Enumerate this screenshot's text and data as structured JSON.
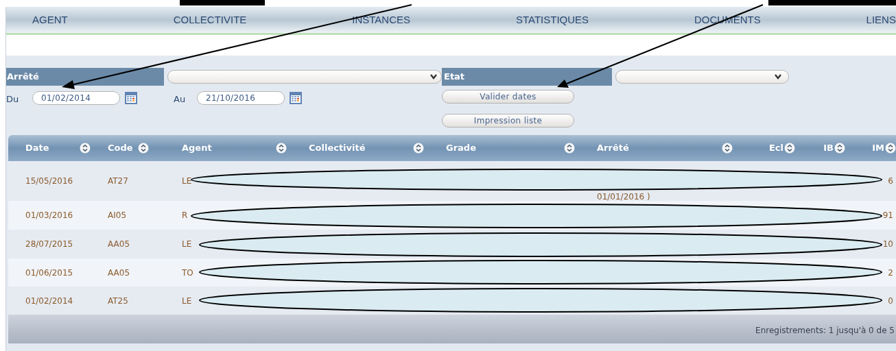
{
  "nav": [
    {
      "label": "AGENT"
    },
    {
      "label": "COLLECTIVITE"
    },
    {
      "label": "INSTANCES"
    },
    {
      "label": "STATISTIQUES"
    },
    {
      "label": "DOCUMENTS"
    },
    {
      "label": "LIENS"
    }
  ],
  "filters": {
    "arrete_label": "Arrêté",
    "etat_label": "Etat",
    "du_label": "Du",
    "du_value": "01/02/2014",
    "au_label": "Au",
    "au_value": "21/10/2016"
  },
  "buttons": [
    "Valider dates",
    "Impression liste"
  ],
  "table": {
    "columns": [
      "Date",
      "Code",
      "Agent",
      "Collectivité",
      "Grade",
      "Arrêté",
      "Ecl",
      "IB",
      "IM"
    ],
    "rows": [
      {
        "date": "15/05/2016",
        "code": "AT27",
        "agent": "LE",
        "arrete": "01/01/2016 )",
        "im": "6"
      },
      {
        "date": "01/03/2016",
        "code": "AI05",
        "agent": "R",
        "im": "91"
      },
      {
        "date": "28/07/2015",
        "code": "AA05",
        "agent": "LE",
        "im": "10"
      },
      {
        "date": "01/06/2015",
        "code": "AA05",
        "agent": "TO",
        "im": "2"
      },
      {
        "date": "01/02/2014",
        "code": "AT25",
        "agent": "LE",
        "im": "0"
      }
    ],
    "footer": "Enregistrements: 1 jusqu'à 0 de 5"
  }
}
